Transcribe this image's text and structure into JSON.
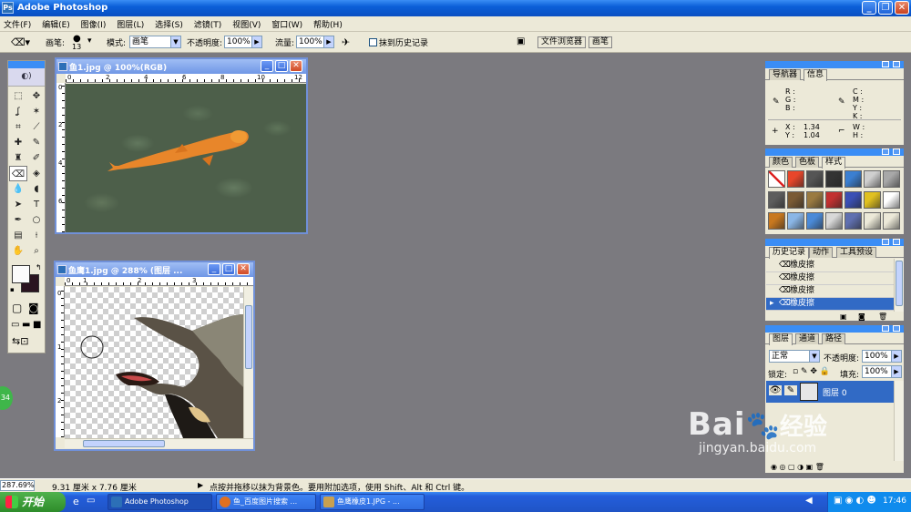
{
  "app": {
    "title": "Adobe Photoshop"
  },
  "menu": [
    "文件(F)",
    "编辑(E)",
    "图像(I)",
    "图层(L)",
    "选择(S)",
    "滤镜(T)",
    "视图(V)",
    "窗口(W)",
    "帮助(H)"
  ],
  "options": {
    "brush_label": "画笔:",
    "brush_size": "13",
    "mode_label": "模式:",
    "mode_value": "画笔",
    "opacity_label": "不透明度:",
    "opacity_value": "100%",
    "flow_label": "流量:",
    "flow_value": "100%",
    "erase_history_label": "抹到历史记录",
    "tab_file_browser": "文件浏览器",
    "tab_brushes": "画笔"
  },
  "doc1": {
    "title": "鱼1.jpg @ 100%(RGB)",
    "ruler_h": [
      "0",
      "2",
      "4",
      "6",
      "8",
      "10",
      "12"
    ],
    "ruler_v": [
      "0",
      "2",
      "4",
      "6"
    ]
  },
  "doc2": {
    "title": "鱼鹰1.jpg @ 288% (图层 ...",
    "ruler_h": [
      "0",
      "1",
      "2",
      "3"
    ],
    "ruler_v": [
      "0",
      "1",
      "2"
    ]
  },
  "navigator": {
    "tab_navigator": "导航器",
    "tab_info": "信息",
    "rgb": "R :\nG :\nB :",
    "cmyk": "C :\nM :\nY :\nK :",
    "x_label": "X :",
    "x_value": "1.34",
    "y_label": "Y :",
    "y_value": "1.04",
    "w_label": "W :",
    "h_label": "H :"
  },
  "color_panel": {
    "tab_color": "颜色",
    "tab_swatches": "色板",
    "tab_styles": "样式",
    "styles": [
      "#ffffff",
      "#e8462a",
      "#555555",
      "#333333",
      "#3b7fd1",
      "#cfcfcf",
      "#a8a8a8",
      "#5d5d5d",
      "#7a5a34",
      "#9a7a40",
      "#c23030",
      "#3a4fb5",
      "#e0c020",
      "#ffffff",
      "#c8781e",
      "#8ab6e6",
      "#4a8ad8",
      "#d8d8d8",
      "#6070b0",
      "#ece9d8",
      "#ece9d8"
    ]
  },
  "history": {
    "tab_history": "历史记录",
    "tab_actions": "动作",
    "tab_tool_presets": "工具预设",
    "items": [
      "橡皮擦",
      "橡皮擦",
      "橡皮擦",
      "橡皮擦"
    ]
  },
  "layers": {
    "tab_layers": "图层",
    "tab_channels": "通道",
    "tab_paths": "路径",
    "blend_mode": "正常",
    "opacity_label": "不透明度:",
    "opacity_value": "100%",
    "lock_label": "锁定:",
    "fill_label": "填充:",
    "fill_value": "100%",
    "layer_name": "图层 0"
  },
  "status": {
    "zoom": "287.69%",
    "doc_size": "9.31 厘米 x 7.76 厘米",
    "hint": "点按并拖移以抹为背景色。要用附加选项，使用 Shift、Alt 和 Ctrl 键。"
  },
  "taskbar": {
    "start": "开始",
    "items": [
      "Adobe Photoshop",
      "鱼_百度图片搜索 ...",
      "鱼鹰橡皮1.JPG - ..."
    ],
    "clock": "17:46"
  },
  "side_badge": "34",
  "watermark": {
    "brand": "Bai",
    "brand2": "经验",
    "url": "jingyan.baidu.com"
  },
  "colors": {
    "titlebar": "#0b5fd8",
    "workspace": "#7b7a7f",
    "selection": "#316ac5"
  }
}
